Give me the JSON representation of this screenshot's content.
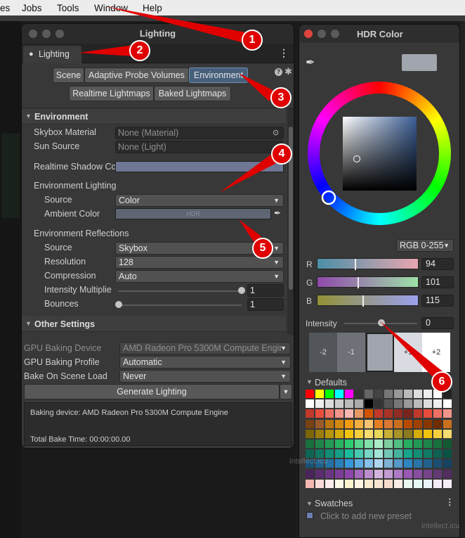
{
  "menubar": {
    "items": [
      "es",
      "Jobs",
      "Tools",
      "Window",
      "Help"
    ]
  },
  "lighting": {
    "title": "Lighting",
    "tab_label": "Lighting",
    "mode_tabs": [
      "Scene",
      "Adaptive Probe Volumes",
      "Environment"
    ],
    "sub_tabs": [
      "Realtime Lightmaps",
      "Baked Lightmaps"
    ],
    "environment": {
      "header": "Environment",
      "skybox_label": "Skybox Material",
      "skybox_value": "None (Material)",
      "sun_label": "Sun Source",
      "sun_value": "None (Light)",
      "shadow_label": "Realtime Shadow Co",
      "env_lighting_label": "Environment Lighting",
      "source_label": "Source",
      "source_value": "Color",
      "ambient_label": "Ambient Color",
      "ambient_value": "HDR",
      "env_reflections_label": "Environment Reflections",
      "refl_source_label": "Source",
      "refl_source_value": "Skybox",
      "resolution_label": "Resolution",
      "resolution_value": "128",
      "compression_label": "Compression",
      "compression_value": "Auto",
      "intensity_label": "Intensity Multiplie",
      "intensity_value": "1",
      "bounces_label": "Bounces",
      "bounces_value": "1"
    },
    "other_settings_header": "Other Settings",
    "gpu_device_label": "GPU Baking Device",
    "gpu_device_value": "AMD Radeon Pro 5300M Compute Engir",
    "gpu_profile_label": "GPU Baking Profile",
    "gpu_profile_value": "Automatic",
    "bake_load_label": "Bake On Scene Load",
    "bake_load_value": "Never",
    "generate_label": "Generate Lighting",
    "status_device": "Baking device: AMD Radeon Pro 5300M Compute Engine",
    "status_time": "Total Bake Time: 00:00:00.00"
  },
  "hdr": {
    "title": "HDR Color",
    "mode_value": "RGB 0-255",
    "channels": [
      {
        "label": "R",
        "value": "94",
        "fraction": 0.37
      },
      {
        "label": "G",
        "value": "101",
        "fraction": 0.4
      },
      {
        "label": "B",
        "value": "115",
        "fraction": 0.45
      }
    ],
    "intensity_label": "Intensity",
    "intensity_value": "0",
    "exposure_stops": [
      "-2",
      "-1",
      "+1",
      "+2"
    ],
    "defaults_label": "Defaults",
    "swatches_label": "Swatches",
    "add_preset_label": "Click to add new preset"
  },
  "callouts": [
    "1",
    "2",
    "3",
    "4",
    "5",
    "6"
  ],
  "watermark": "intellect.icu"
}
